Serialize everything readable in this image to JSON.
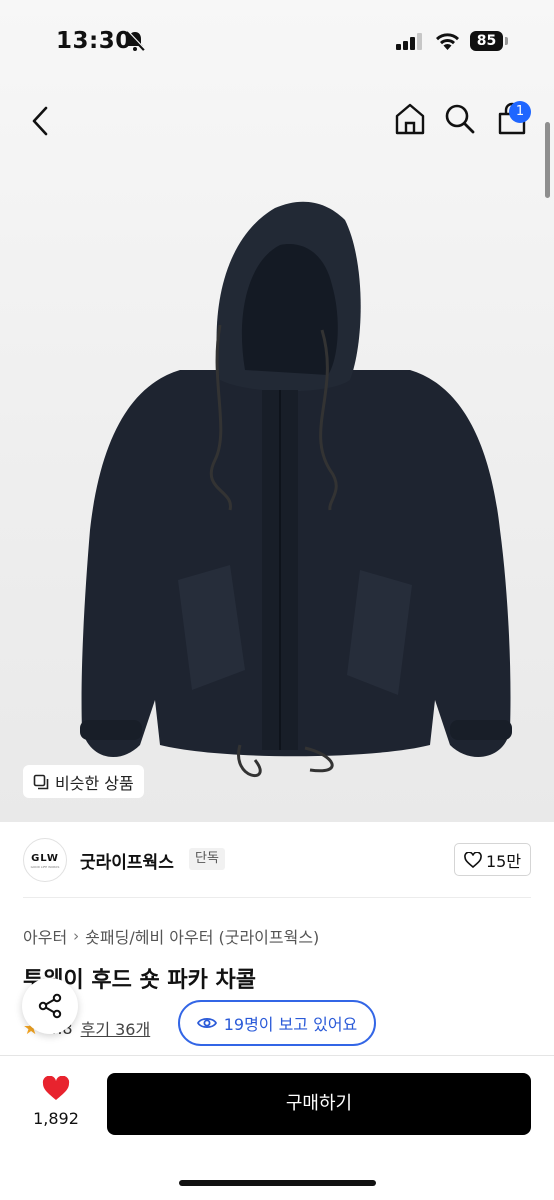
{
  "status_bar": {
    "time": "13:30",
    "battery": "85"
  },
  "nav": {
    "cart_count": "1"
  },
  "similar_products_label": "비슷한 상품",
  "brand": {
    "logo_text": "GLW",
    "logo_subtext": "GOOD LIFE WORKS",
    "name": "굿라이프웍스",
    "exclusive_label": "단독",
    "like_count": "15만"
  },
  "breadcrumb": [
    "아우터",
    "숏패딩/헤비 아우터 (굿라이프웍스)"
  ],
  "product": {
    "title": "투웨이 후드 숏 파카 차콜",
    "rating": "4.8",
    "reviews": "후기 36개",
    "viewing": "19명이 보고 있어요"
  },
  "bottom_bar": {
    "wish_count": "1,892",
    "buy_label": "구매하기"
  },
  "colors": {
    "accent": "#3366e6",
    "badge": "#1f66ff",
    "heart": "#e8232e",
    "jacket": "#1e2430"
  }
}
